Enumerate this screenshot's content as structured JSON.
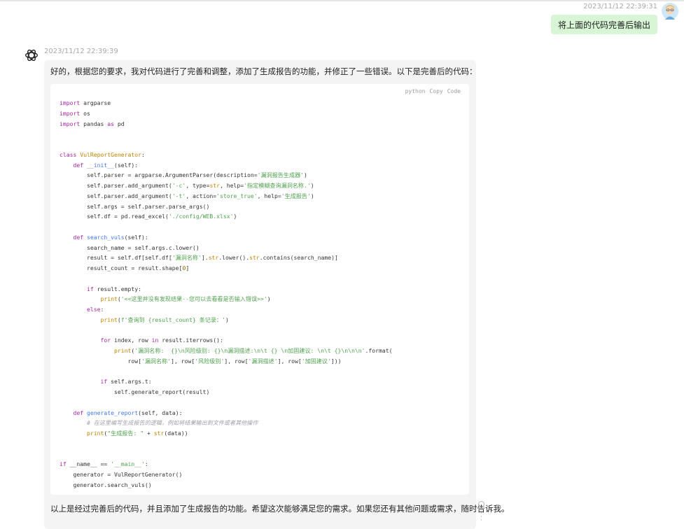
{
  "user": {
    "timestamp": "2023/11/12 22:39:31",
    "message": "将上面的代码完善后输出"
  },
  "assistant": {
    "timestamp": "2023/11/12 22:39:39",
    "intro": "好的，根据您的要求，我对代码进行了完善和调整，添加了生成报告的功能，并修正了一些错误。以下是完善后的代码：",
    "code_block": {
      "language": "python",
      "copy_label": "Copy",
      "code_label": "Code",
      "lines": [
        "import argparse",
        "import os",
        "import pandas as pd",
        "",
        "",
        "class VulReportGenerator:",
        "    def __init__(self):",
        "        self.parser = argparse.ArgumentParser(description='漏洞报告生成器')",
        "        self.parser.add_argument('-c', type=str, help='指定模糊查询漏洞名称.')",
        "        self.parser.add_argument('-t', action='store_true', help='生成报告')",
        "        self.args = self.parser.parse_args()",
        "        self.df = pd.read_excel('./config/WEB.xlsx')",
        "",
        "    def search_vuls(self):",
        "        search_name = self.args.c.lower()",
        "        result = self.df[self.df['漏洞名称'].str.lower().str.contains(search_name)]",
        "        result_count = result.shape[0]",
        "",
        "        if result.empty:",
        "            print('<<这里并没有发现结果--您可以去看看是否输入错误>>')",
        "        else:",
        "            print(f'查询到 {result_count} 条记录：')",
        "",
        "            for index, row in result.iterrows():",
        "                print('漏洞名称:  {}\\n风险级别: {}\\n漏洞描述:\\n\\t {} \\n加固建议: \\n\\t {}\\n\\n\\n'.format(",
        "                    row['漏洞名称'], row['风险级别'], row['漏洞描述'], row['加固建议']))",
        "",
        "            if self.args.t:",
        "                self.generate_report(result)",
        "",
        "    def generate_report(self, data):",
        "        # 在这里编写生成报告的逻辑，例如将结果输出到文件或者其他操作",
        "        print(\"生成报告: \" + str(data))",
        "",
        "",
        "if __name__ == '__main__':",
        "    generator = VulReportGenerator()",
        "    generator.search_vuls()"
      ]
    },
    "outro": "以上是经过完善后的代码，并且添加了生成报告的功能。希望这次能够满足您的需求。如果您还有其他问题或需求，随时告诉我。"
  }
}
